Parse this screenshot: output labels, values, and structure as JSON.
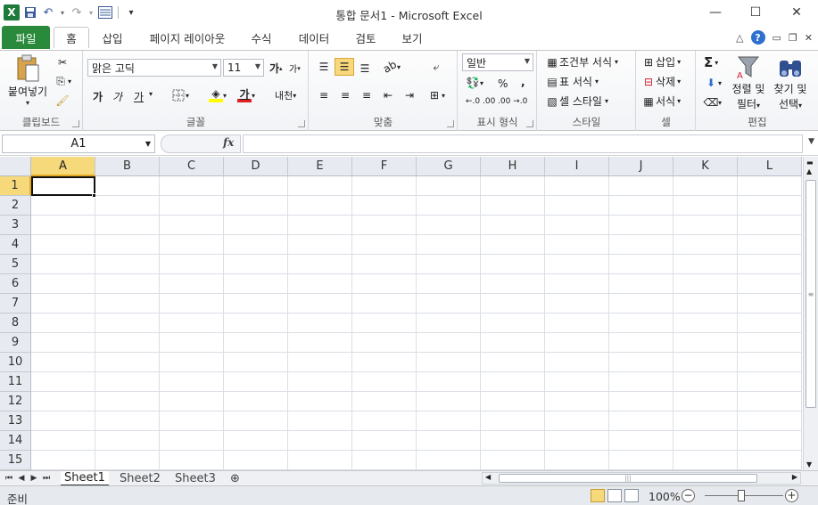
{
  "window": {
    "title": "통합 문서1 - Microsoft Excel",
    "minimize": "—",
    "maximize": "☐",
    "close": "✕"
  },
  "qat": {
    "excel_logo": "X",
    "save_icon": "save-icon",
    "undo_icon": "undo-icon",
    "redo_icon": "redo-icon",
    "customize": "▾"
  },
  "tabs": [
    "파일",
    "홈",
    "삽입",
    "페이지 레이아웃",
    "수식",
    "데이터",
    "검토",
    "보기"
  ],
  "ribbon": {
    "clipboard": {
      "label": "클립보드",
      "paste": "붙여넣기"
    },
    "font": {
      "label": "글꼴",
      "font_name": "맑은 고딕",
      "font_size": "11",
      "grow": "가",
      "shrink": "가",
      "bold": "가",
      "italic": "가",
      "underline": "가",
      "phonetic": "내천"
    },
    "alignment": {
      "label": "맞춤"
    },
    "number": {
      "label": "표시 형식",
      "format": "일반",
      "percent": "%",
      "comma": ",",
      "inc_decimal": "←.0 .00",
      "dec_decimal": ".00 →.0"
    },
    "styles": {
      "label": "스타일",
      "conditional": "조건부 서식",
      "format_table": "표 서식",
      "cell_styles": "셀 스타일"
    },
    "cells": {
      "label": "셀",
      "insert": "삽입",
      "delete": "삭제",
      "format": "서식"
    },
    "editing": {
      "label": "편집",
      "sum": "Σ",
      "sort_filter_1": "정렬 및",
      "sort_filter_2": "필터",
      "find_select_1": "찾기 및",
      "find_select_2": "선택"
    }
  },
  "formula_bar": {
    "name_box": "A1",
    "fx": "fx",
    "formula": ""
  },
  "grid": {
    "columns": [
      "A",
      "B",
      "C",
      "D",
      "E",
      "F",
      "G",
      "H",
      "I",
      "J",
      "K",
      "L"
    ],
    "rows": [
      "1",
      "2",
      "3",
      "4",
      "5",
      "6",
      "7",
      "8",
      "9",
      "10",
      "11",
      "12",
      "13",
      "14",
      "15"
    ],
    "selected_cell": "A1"
  },
  "sheets": [
    "Sheet1",
    "Sheet2",
    "Sheet3"
  ],
  "status": {
    "ready": "준비",
    "zoom": "100%",
    "zoom_minus": "−",
    "zoom_plus": "+"
  },
  "colors": {
    "file_tab": "#2a8a3c",
    "selection_header": "#f5d97a",
    "accent": "#e2a822"
  }
}
